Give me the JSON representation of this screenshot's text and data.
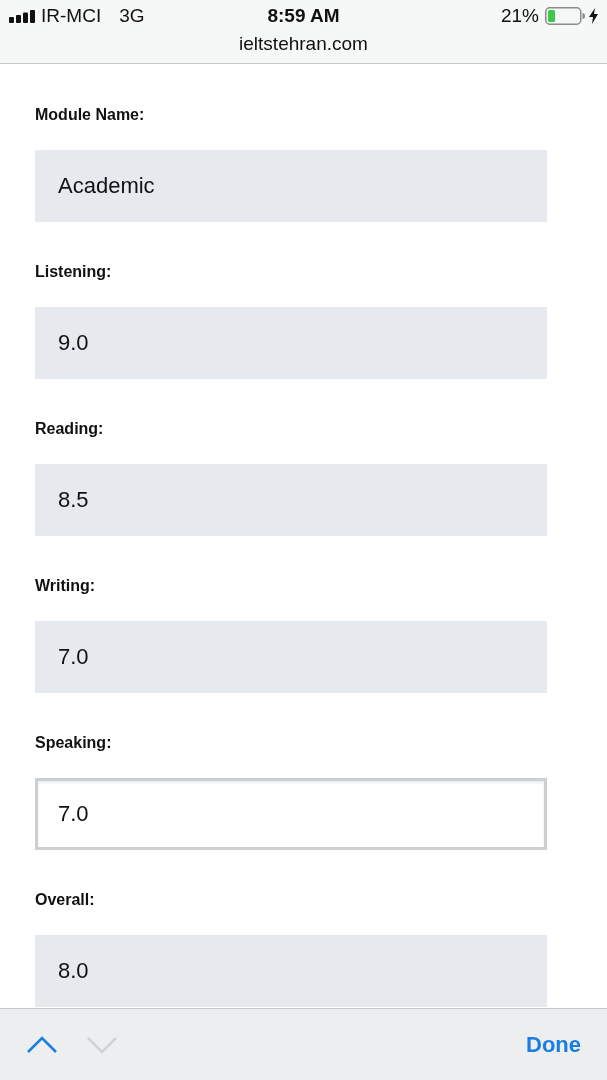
{
  "status_bar": {
    "carrier": "IR-MCI",
    "network": "3G",
    "time": "8:59 AM",
    "battery_percent": "21%",
    "url": "ieltstehran.com"
  },
  "form": {
    "fields": [
      {
        "label": "Module Name:",
        "value": "Academic",
        "focused": false
      },
      {
        "label": "Listening:",
        "value": "9.0",
        "focused": false
      },
      {
        "label": "Reading:",
        "value": "8.5",
        "focused": false
      },
      {
        "label": "Writing:",
        "value": "7.0",
        "focused": false
      },
      {
        "label": "Speaking:",
        "value": "7.0",
        "focused": true
      },
      {
        "label": "Overall:",
        "value": "8.0",
        "focused": false
      }
    ]
  },
  "toolbar": {
    "buttons": [
      {
        "kind": "previous",
        "disabled": false
      },
      {
        "kind": "next",
        "disabled": true
      }
    ],
    "done": "Done"
  }
}
